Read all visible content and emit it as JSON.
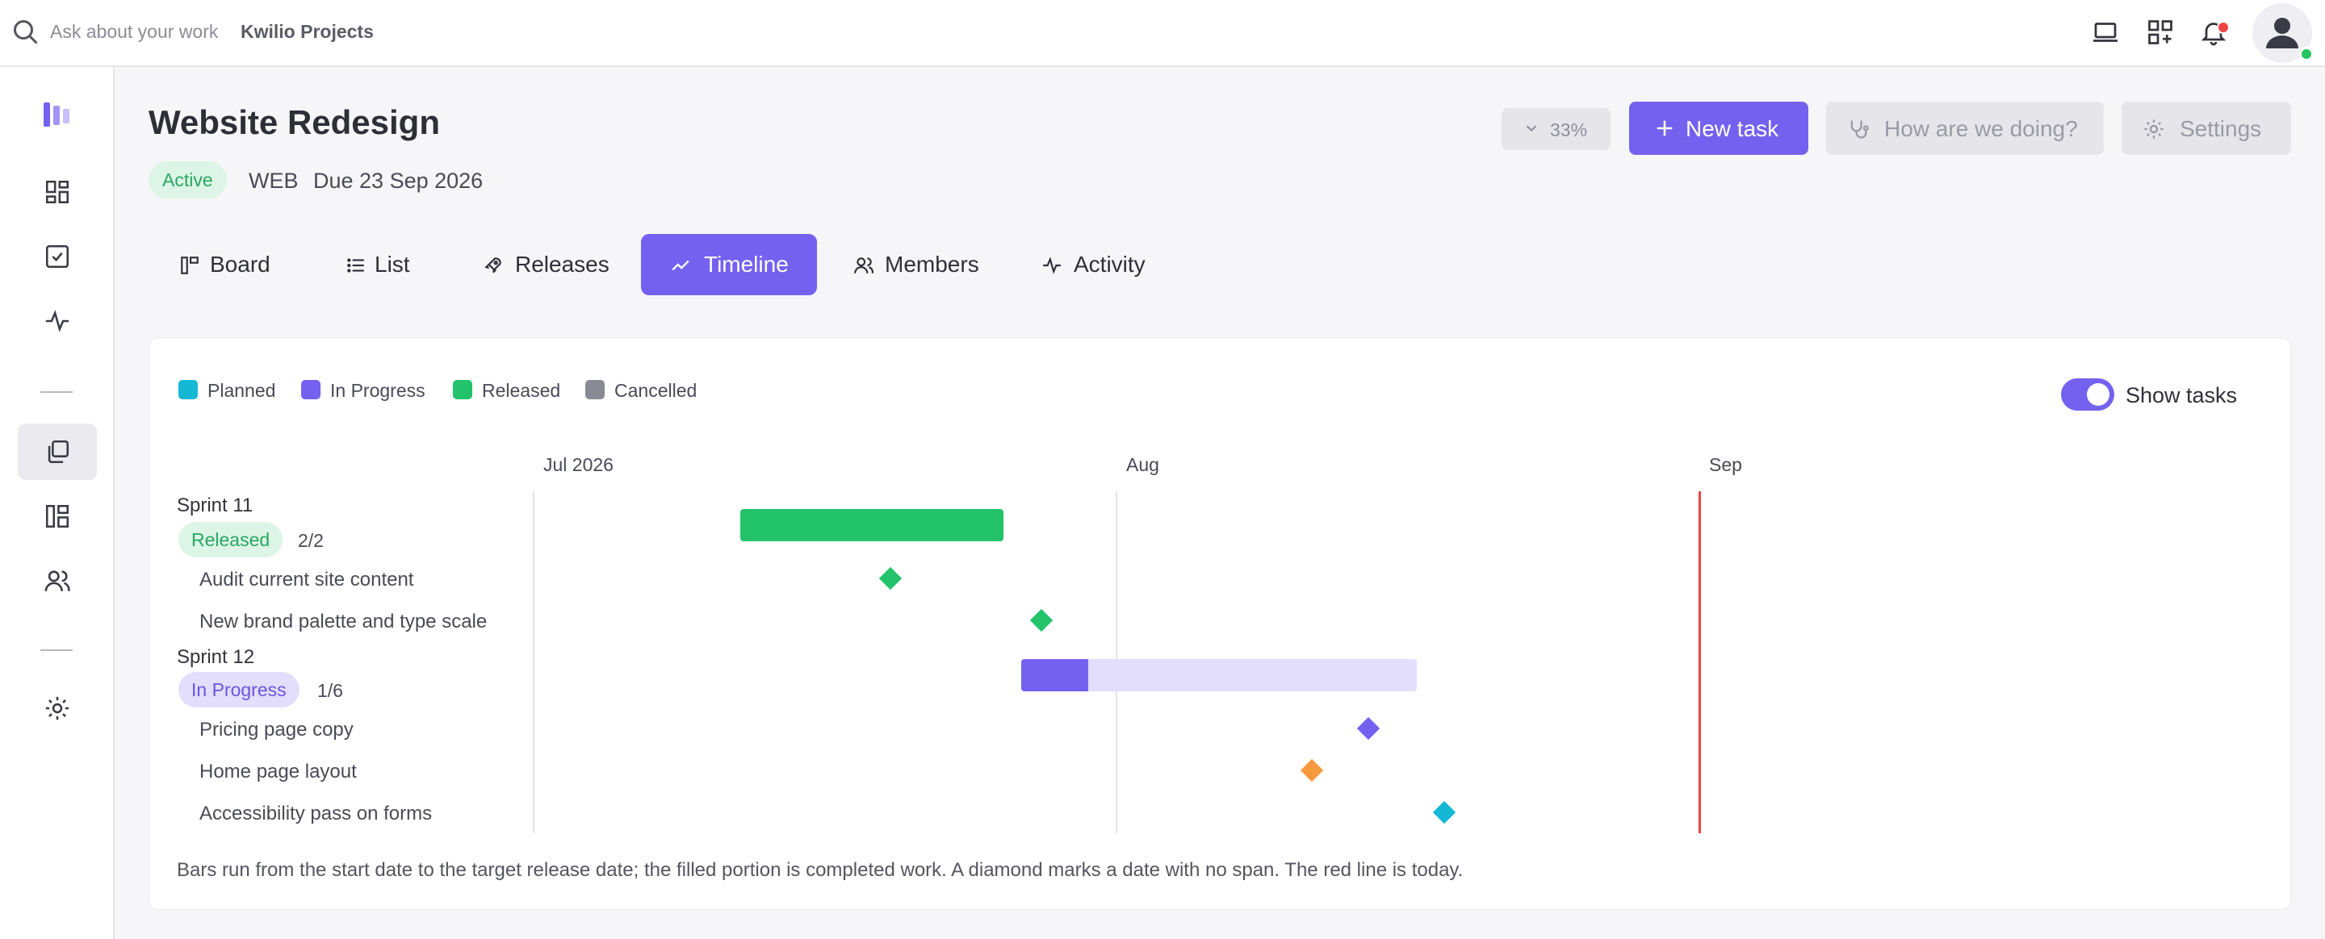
{
  "topbar": {
    "search_placeholder": "Ask about your work",
    "app_name": "Kwilio Projects"
  },
  "header": {
    "title": "Website Redesign",
    "status": "Active",
    "key": "WEB",
    "due": "Due 23 Sep 2026",
    "zoom": "33%",
    "new_task_label": "New task",
    "feedback_label": "How are we doing?",
    "settings_label": "Settings"
  },
  "tabs": [
    {
      "label": "Board",
      "active": false
    },
    {
      "label": "List",
      "active": false
    },
    {
      "label": "Releases",
      "active": false
    },
    {
      "label": "Timeline",
      "active": true
    },
    {
      "label": "Members",
      "active": false
    },
    {
      "label": "Activity",
      "active": false
    }
  ],
  "timeline": {
    "legend": [
      {
        "label": "Planned",
        "color": "#14b8d4"
      },
      {
        "label": "In Progress",
        "color": "#7561ef"
      },
      {
        "label": "Released",
        "color": "#22c36b"
      },
      {
        "label": "Cancelled",
        "color": "#8a8a94"
      }
    ],
    "show_tasks_label": "Show tasks",
    "show_tasks": true,
    "months": [
      "Jul 2026",
      "Aug",
      "Sep"
    ],
    "sprints": [
      {
        "name": "Sprint 11",
        "status": "Released",
        "count": "2/2",
        "tasks": [
          {
            "label": "Audit current site content",
            "color": "#22c36b"
          },
          {
            "label": "New brand palette and type scale",
            "color": "#22c36b"
          }
        ]
      },
      {
        "name": "Sprint 12",
        "status": "In Progress",
        "count": "1/6",
        "progress": 0.17,
        "tasks": [
          {
            "label": "Pricing page copy",
            "color": "#7561ef"
          },
          {
            "label": "Home page layout",
            "color": "#f59a3e"
          },
          {
            "label": "Accessibility pass on forms",
            "color": "#14b8d4"
          }
        ]
      }
    ],
    "footnote": "Bars run from the start date to the target release date; the filled portion is completed work. A diamond marks a date with no span. The red line is today."
  },
  "colors": {
    "accent": "#7561ef",
    "released": "#22c36b",
    "in_progress_light": "#e2defb",
    "today": "#ef4444"
  }
}
